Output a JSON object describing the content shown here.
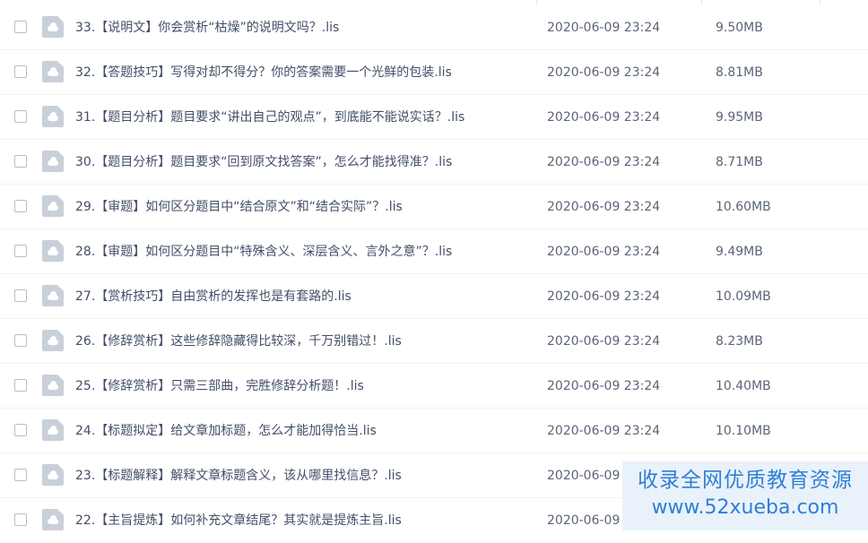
{
  "files": [
    {
      "name": "33.【说明文】你会赏析“枯燥”的说明文吗？.lis",
      "date": "2020-06-09 23:24",
      "size": "9.50MB"
    },
    {
      "name": "32.【答题技巧】写得对却不得分？你的答案需要一个光鲜的包装.lis",
      "date": "2020-06-09 23:24",
      "size": "8.81MB"
    },
    {
      "name": "31.【题目分析】题目要求“讲出自己的观点”，到底能不能说实话？.lis",
      "date": "2020-06-09 23:24",
      "size": "9.95MB"
    },
    {
      "name": "30.【题目分析】题目要求“回到原文找答案”，怎么才能找得准？.lis",
      "date": "2020-06-09 23:24",
      "size": "8.71MB"
    },
    {
      "name": "29.【审题】如何区分题目中“结合原文”和“结合实际”？.lis",
      "date": "2020-06-09 23:24",
      "size": "10.60MB"
    },
    {
      "name": "28.【审题】如何区分题目中“特殊含义、深层含义、言外之意”？.lis",
      "date": "2020-06-09 23:24",
      "size": "9.49MB"
    },
    {
      "name": "27.【赏析技巧】自由赏析的发挥也是有套路的.lis",
      "date": "2020-06-09 23:24",
      "size": "10.09MB"
    },
    {
      "name": "26.【修辞赏析】这些修辞隐藏得比较深，千万别错过！.lis",
      "date": "2020-06-09 23:24",
      "size": "8.23MB"
    },
    {
      "name": "25.【修辞赏析】只需三部曲，完胜修辞分析题！.lis",
      "date": "2020-06-09 23:24",
      "size": "10.40MB"
    },
    {
      "name": "24.【标题拟定】给文章加标题，怎么才能加得恰当.lis",
      "date": "2020-06-09 23:24",
      "size": "10.10MB"
    },
    {
      "name": "23.【标题解释】解释文章标题含义，该从哪里找信息？.lis",
      "date": "2020-06-09",
      "size": ""
    },
    {
      "name": "22.【主旨提炼】如何补充文章结尾？其实就是提炼主旨.lis",
      "date": "2020-06-09",
      "size": ""
    }
  ],
  "watermark": {
    "line1": "收录全网优质教育资源",
    "line2": "www.52xueba.com"
  },
  "colors": {
    "text": "#424e67",
    "icon": "#c9d0da",
    "watermark_text": "#2f7fd6",
    "watermark_bg": "#e9f2fa"
  },
  "icons": {
    "file_icon": "file-cloud-icon",
    "checkbox": "checkbox"
  }
}
